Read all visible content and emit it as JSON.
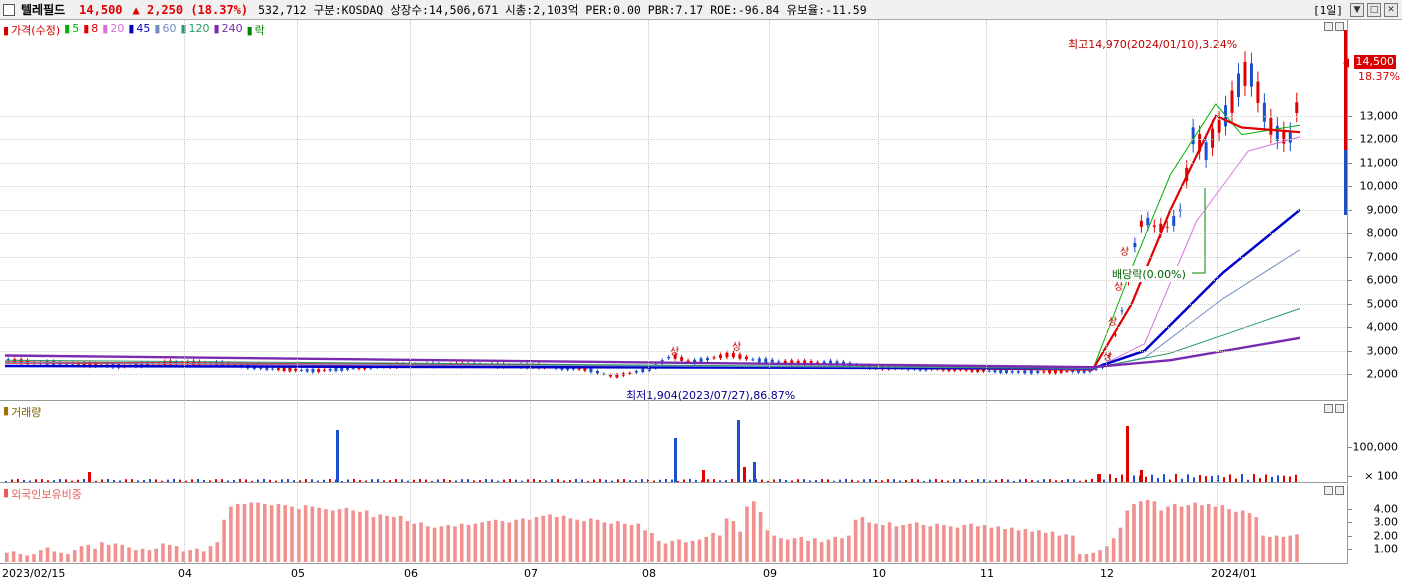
{
  "header": {
    "stock_name": "텔레필드",
    "price": "14,500",
    "change": "▲ 2,250 (18.37%)",
    "volume": "532,712",
    "market": "구분:KOSDAQ",
    "listed_shares": "상장수:14,506,671",
    "market_cap": "시총:2,103억",
    "per": "PER:0.00",
    "pbr": "PBR:7.17",
    "roe": "ROE:-96.84",
    "retention": "유보율:-11.59",
    "period": "[1일]",
    "window_buttons": [
      "▼",
      "□",
      "✕"
    ]
  },
  "price_legend": [
    {
      "label": "가격(수정)",
      "color": "#d40000"
    },
    {
      "label": "5",
      "color": "#00b000"
    },
    {
      "label": "8",
      "color": "#e00000"
    },
    {
      "label": "20",
      "color": "#d870d8"
    },
    {
      "label": "45",
      "color": "#0000cc"
    },
    {
      "label": "60",
      "color": "#7090c0"
    },
    {
      "label": "120",
      "color": "#2a9a6a"
    },
    {
      "label": "240",
      "color": "#7a2ab0"
    },
    {
      "label": "락",
      "color": "#008000"
    }
  ],
  "volume_legend": "거래량",
  "foreign_legend": "외국인보유비중",
  "annotations": {
    "high": "최고14,970(2024/01/10),3.24%",
    "low": "최저1,904(2023/07/27),86.87%",
    "dividend": "배당락(0.00%)",
    "limit_up": "상"
  },
  "current": {
    "price_tag": "14,500",
    "pct_tag": "18.37%"
  },
  "chart_data": [
    {
      "type": "candlestick",
      "title": "",
      "ylim": [
        1500,
        15800
      ],
      "y_ticks": [
        "13,000",
        "12,000",
        "11,000",
        "10,000",
        "9,000",
        "8,000",
        "7,000",
        "6,000",
        "5,000",
        "4,000",
        "3,000",
        "2,000"
      ],
      "x_ticks": [
        "2023/02/15",
        "04",
        "05",
        "06",
        "07",
        "08",
        "09",
        "10",
        "11",
        "12",
        "2024/01"
      ],
      "series": [
        {
          "name": "가격(수정)",
          "points": [
            [
              "2023/02/15",
              2650
            ],
            [
              "2023/04",
              2450
            ],
            [
              "2023/05",
              2150
            ],
            [
              "2023/06",
              2400
            ],
            [
              "2023/07",
              2300
            ],
            [
              "2023/07/27",
              1904
            ],
            [
              "2023/08",
              2500
            ],
            [
              "2023/09",
              2550
            ],
            [
              "2023/10",
              2300
            ],
            [
              "2023/11",
              2100
            ],
            [
              "2023/12",
              2200
            ],
            [
              "2023/12 mid",
              8300
            ],
            [
              "2023/12 late",
              11800
            ],
            [
              "2024/01/10",
              14970
            ],
            [
              "2024/01 mid",
              12100
            ],
            [
              "2024/01 last",
              14500
            ]
          ]
        },
        {
          "name": "5",
          "points": [
            [
              0,
              2500
            ],
            [
              0.5,
              2350
            ],
            [
              0.84,
              2200
            ],
            [
              0.87,
              6500
            ],
            [
              0.9,
              10500
            ],
            [
              0.935,
              13500
            ],
            [
              0.955,
              12200
            ],
            [
              1,
              12600
            ]
          ]
        },
        {
          "name": "8",
          "points": [
            [
              0,
              2500
            ],
            [
              0.5,
              2350
            ],
            [
              0.84,
              2200
            ],
            [
              0.87,
              5000
            ],
            [
              0.9,
              9000
            ],
            [
              0.935,
              13000
            ],
            [
              0.955,
              12500
            ],
            [
              1,
              12300
            ]
          ]
        },
        {
          "name": "20",
          "points": [
            [
              0,
              2500
            ],
            [
              0.84,
              2200
            ],
            [
              0.88,
              3300
            ],
            [
              0.92,
              8500
            ],
            [
              0.96,
              11500
            ],
            [
              1,
              12100
            ]
          ]
        },
        {
          "name": "45",
          "points": [
            [
              0,
              2350
            ],
            [
              0.84,
              2250
            ],
            [
              0.88,
              3000
            ],
            [
              0.94,
              6300
            ],
            [
              1,
              9000
            ]
          ]
        },
        {
          "name": "60",
          "points": [
            [
              0,
              2500
            ],
            [
              0.84,
              2250
            ],
            [
              0.88,
              2700
            ],
            [
              0.94,
              5200
            ],
            [
              1,
              7300
            ]
          ]
        },
        {
          "name": "120",
          "points": [
            [
              0,
              2600
            ],
            [
              0.84,
              2250
            ],
            [
              0.9,
              2900
            ],
            [
              1,
              4800
            ]
          ]
        },
        {
          "name": "240",
          "points": [
            [
              0,
              2800
            ],
            [
              0.84,
              2300
            ],
            [
              0.9,
              2600
            ],
            [
              1,
              3550
            ]
          ]
        }
      ]
    },
    {
      "type": "bar",
      "title": "거래량",
      "y_ticks": [
        "100,000",
        "× 100"
      ],
      "peaks": [
        [
          "2023/05",
          0.55
        ],
        [
          "2023/08 a",
          0.83
        ],
        [
          "2023/08 b",
          1.0
        ],
        [
          "2023/12",
          0.92
        ]
      ]
    },
    {
      "type": "bar",
      "title": "외국인보유비중",
      "y_ticks": [
        "4.00",
        "3.00",
        "2.00",
        "1.00"
      ],
      "ylim": [
        0,
        5.3
      ],
      "values": [
        0.7,
        0.8,
        0.6,
        0.5,
        0.6,
        0.9,
        1.1,
        0.8,
        0.7,
        0.6,
        0.9,
        1.2,
        1.3,
        1.0,
        1.5,
        1.3,
        1.4,
        1.3,
        1.1,
        0.9,
        1.0,
        0.9,
        1.0,
        1.4,
        1.3,
        1.2,
        0.8,
        0.9,
        1.0,
        0.8,
        1.2,
        1.5,
        3.2,
        4.2,
        4.4,
        4.4,
        4.5,
        4.5,
        4.4,
        4.3,
        4.4,
        4.3,
        4.2,
        4.0,
        4.3,
        4.2,
        4.1,
        4.0,
        3.9,
        4.0,
        4.1,
        3.9,
        3.8,
        3.9,
        3.4,
        3.6,
        3.5,
        3.4,
        3.5,
        3.1,
        2.9,
        3.0,
        2.7,
        2.6,
        2.7,
        2.8,
        2.7,
        2.9,
        2.8,
        2.9,
        3.0,
        3.1,
        3.2,
        3.1,
        3.0,
        3.2,
        3.3,
        3.2,
        3.4,
        3.5,
        3.6,
        3.4,
        3.5,
        3.3,
        3.2,
        3.1,
        3.3,
        3.2,
        3.0,
        2.9,
        3.1,
        2.9,
        2.8,
        2.9,
        2.4,
        2.2,
        1.6,
        1.4,
        1.6,
        1.7,
        1.5,
        1.6,
        1.7,
        1.9,
        2.2,
        2.0,
        3.3,
        3.1,
        2.3,
        4.2,
        4.6,
        3.8,
        2.4,
        2.0,
        1.8,
        1.7,
        1.8,
        1.9,
        1.6,
        1.8,
        1.5,
        1.7,
        1.9,
        1.8,
        2.0,
        3.2,
        3.4,
        3.0,
        2.9,
        2.8,
        3.0,
        2.7,
        2.8,
        2.9,
        3.0,
        2.8,
        2.7,
        2.9,
        2.8,
        2.7,
        2.6,
        2.8,
        2.9,
        2.7,
        2.8,
        2.6,
        2.7,
        2.5,
        2.6,
        2.4,
        2.5,
        2.3,
        2.4,
        2.2,
        2.3,
        2.0,
        2.1,
        2.0,
        0.6,
        0.6,
        0.7,
        0.9,
        1.2,
        1.8,
        2.6,
        3.9,
        4.4,
        4.6,
        4.7,
        4.6,
        3.9,
        4.2,
        4.4,
        4.2,
        4.3,
        4.5,
        4.3,
        4.4,
        4.2,
        4.3,
        4.0,
        3.8,
        3.9,
        3.7,
        3.4,
        2.0,
        1.9,
        2.0,
        1.9,
        2.0,
        2.1
      ]
    }
  ]
}
